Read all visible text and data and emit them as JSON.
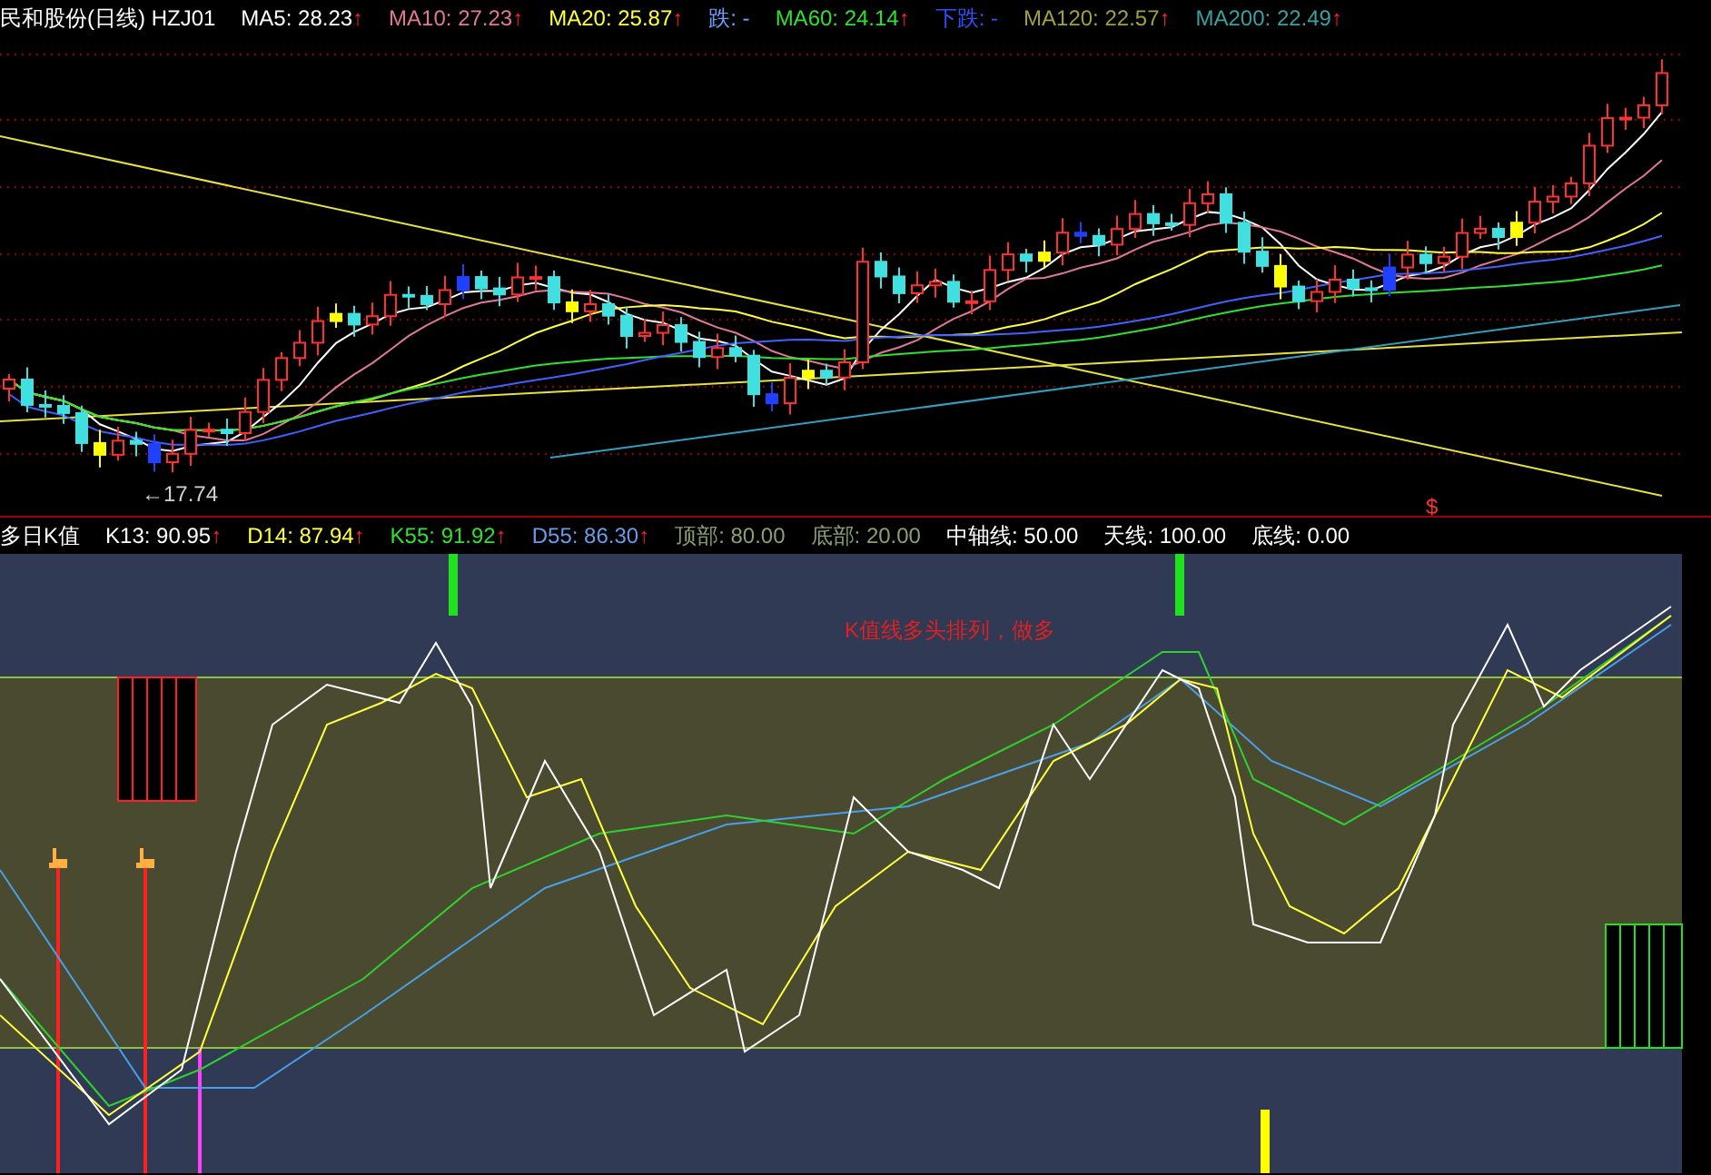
{
  "main_chart": {
    "header": [
      {
        "text": "民和股份(日线) HZJ01",
        "color": "#ffffff"
      },
      {
        "text": "MA5: 28.23",
        "color": "#ffffff",
        "arrow": "↑"
      },
      {
        "text": "MA10: 27.23",
        "color": "#e07896",
        "arrow": "↑"
      },
      {
        "text": "MA20: 25.87",
        "color": "#ffff40",
        "arrow": "↑"
      },
      {
        "text": "跌: -",
        "color": "#6aa0ff"
      },
      {
        "text": "MA60: 24.14",
        "color": "#30e030",
        "arrow": "↑"
      },
      {
        "text": "下跌: -",
        "color": "#3050ff"
      },
      {
        "text": "MA120: 22.57",
        "color": "#a0a040",
        "arrow": "↑"
      },
      {
        "text": "MA200: 22.49",
        "color": "#3aa0a0",
        "arrow": "↑"
      }
    ],
    "low_label": "←17.74",
    "signal_mark": "$"
  },
  "indicator": {
    "header": [
      {
        "text": "多日K值",
        "color": "#ffffff"
      },
      {
        "text": "K13: 90.95",
        "color": "#ffffff",
        "arrow": "↑"
      },
      {
        "text": "D14: 87.94",
        "color": "#ffff40",
        "arrow": "↑"
      },
      {
        "text": "K55: 91.92",
        "color": "#30e030",
        "arrow": "↑"
      },
      {
        "text": "D55: 86.30",
        "color": "#6a9ae8",
        "arrow": "↑"
      },
      {
        "text": "顶部: 80.00",
        "color": "#8aa070"
      },
      {
        "text": "底部: 20.00",
        "color": "#8aa070"
      },
      {
        "text": "中轴线: 50.00",
        "color": "#ffffff"
      },
      {
        "text": "天线: 100.00",
        "color": "#ffffff"
      },
      {
        "text": "底线: 0.00",
        "color": "#ffffff"
      }
    ],
    "annotation": "K值线多头排列，做多"
  }
}
